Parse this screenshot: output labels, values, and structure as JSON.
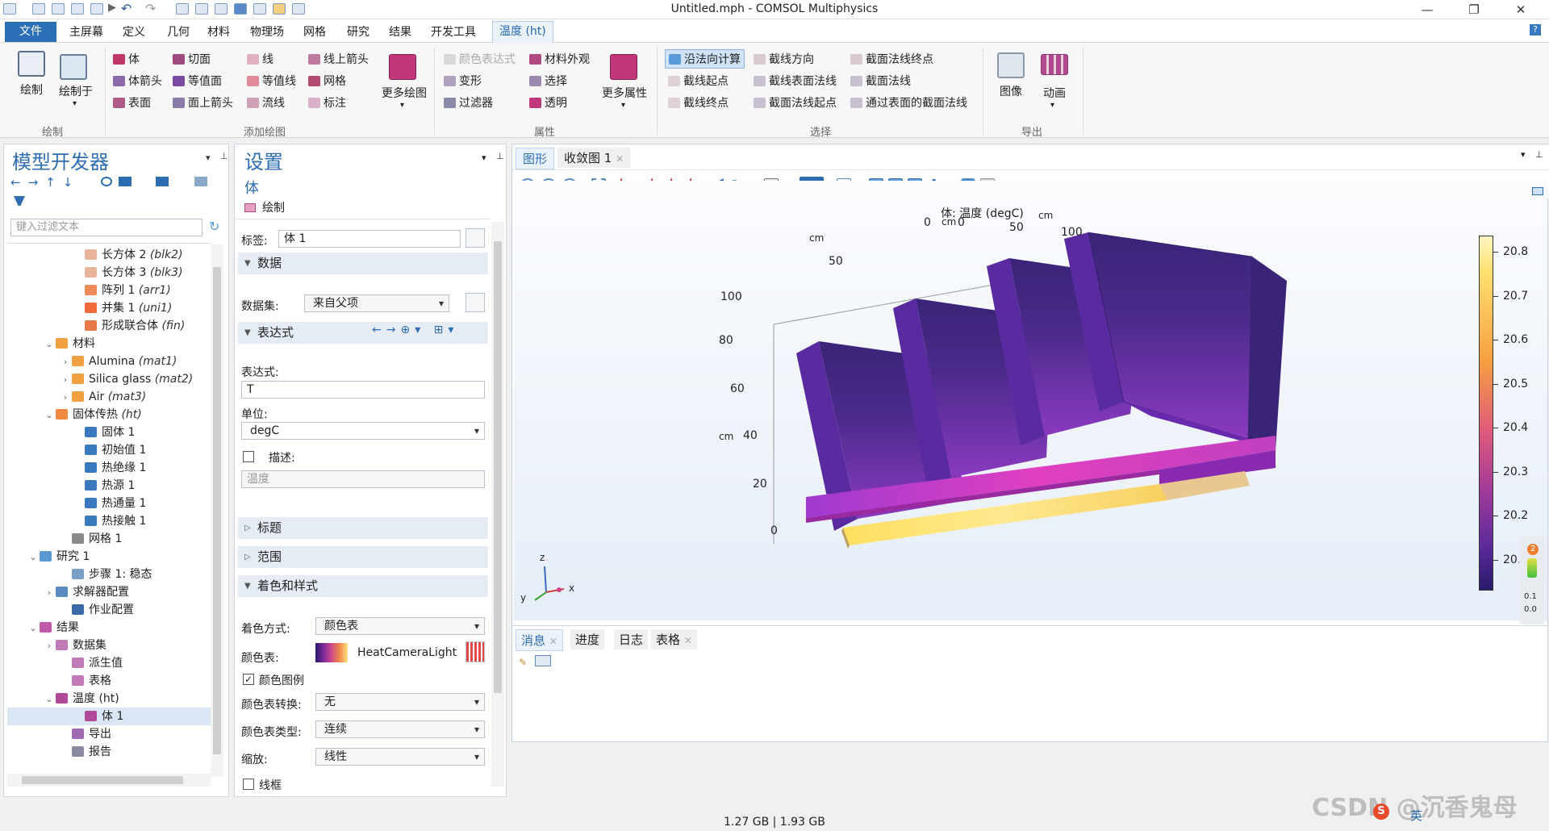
{
  "window": {
    "title": "Untitled.mph - COMSOL Multiphysics"
  },
  "menu": {
    "file": "文件",
    "items": [
      "主屏幕",
      "定义",
      "几何",
      "材料",
      "物理场",
      "网格",
      "研究",
      "结果",
      "开发工具"
    ],
    "context_tab": "温度 (ht)",
    "help": "?"
  },
  "ribbon": {
    "plot": {
      "label": "绘制",
      "plot_in": "绘制于",
      "group": "绘制"
    },
    "add_plot": {
      "group": "添加绘图",
      "col1": [
        "体",
        "体箭头",
        "表面"
      ],
      "col2": [
        "切面",
        "等值面",
        "面上箭头"
      ],
      "col3": [
        "线",
        "等值线",
        "流线"
      ],
      "col4": [
        "线上箭头",
        "网格",
        "标注"
      ],
      "more": "更多绘图"
    },
    "attributes": {
      "group": "属性",
      "col1": [
        "颜色表达式",
        "变形",
        "过滤器"
      ],
      "col2": [
        "材料外观",
        "选择",
        "透明"
      ],
      "more": "更多属性"
    },
    "selection": {
      "group": "选择",
      "col1": [
        "沿法向计算",
        "截线起点",
        "截线终点"
      ],
      "col2": [
        "截线方向",
        "截线表面法线",
        "截面法线起点"
      ],
      "col3": [
        "截面法线终点",
        "截面法线",
        "通过表面的截面法线"
      ]
    },
    "export": {
      "group": "导出",
      "image": "图像",
      "animation": "动画"
    }
  },
  "model_builder": {
    "title": "模型开发器",
    "filter_placeholder": "键入过滤文本",
    "tree": [
      {
        "label": "长方体 2",
        "tag": "(blk2)",
        "indent": 80,
        "arrow": "",
        "color": "#e8b49a"
      },
      {
        "label": "长方体 3",
        "tag": "(blk3)",
        "indent": 80,
        "arrow": "",
        "color": "#e8b49a"
      },
      {
        "label": "阵列 1",
        "tag": "(arr1)",
        "indent": 80,
        "arrow": "",
        "color": "#f08a5a"
      },
      {
        "label": "并集 1",
        "tag": "(uni1)",
        "indent": 80,
        "arrow": "",
        "color": "#f06a3a"
      },
      {
        "label": "形成联合体",
        "tag": "(fin)",
        "indent": 80,
        "arrow": "",
        "color": "#e87a4a"
      },
      {
        "label": "材料",
        "tag": "",
        "indent": 44,
        "arrow": "⌄",
        "color": "#f0a040"
      },
      {
        "label": "Alumina",
        "tag": "(mat1)",
        "indent": 64,
        "arrow": "›",
        "color": "#f0a040"
      },
      {
        "label": "Silica glass",
        "tag": "(mat2)",
        "indent": 64,
        "arrow": "›",
        "color": "#f0a040"
      },
      {
        "label": "Air",
        "tag": "(mat3)",
        "indent": 64,
        "arrow": "›",
        "color": "#f0a040"
      },
      {
        "label": "固体传热",
        "tag": "(ht)",
        "indent": 44,
        "arrow": "⌄",
        "color": "#f08a40"
      },
      {
        "label": "固体 1",
        "tag": "",
        "indent": 80,
        "arrow": "",
        "color": "#3a78c0"
      },
      {
        "label": "初始值 1",
        "tag": "",
        "indent": 80,
        "arrow": "",
        "color": "#3a78c0"
      },
      {
        "label": "热绝缘 1",
        "tag": "",
        "indent": 80,
        "arrow": "",
        "color": "#3a78c0"
      },
      {
        "label": "热源 1",
        "tag": "",
        "indent": 80,
        "arrow": "",
        "color": "#3a78c0"
      },
      {
        "label": "热通量 1",
        "tag": "",
        "indent": 80,
        "arrow": "",
        "color": "#3a78c0"
      },
      {
        "label": "热接触 1",
        "tag": "",
        "indent": 80,
        "arrow": "",
        "color": "#3a78c0"
      },
      {
        "label": "网格 1",
        "tag": "",
        "indent": 64,
        "arrow": "",
        "color": "#8a8a8a"
      },
      {
        "label": "研究 1",
        "tag": "",
        "indent": 24,
        "arrow": "⌄",
        "color": "#5a9ad0"
      },
      {
        "label": "步骤 1: 稳态",
        "tag": "",
        "indent": 64,
        "arrow": "",
        "color": "#7aa0c8"
      },
      {
        "label": "求解器配置",
        "tag": "",
        "indent": 44,
        "arrow": "›",
        "color": "#5a8ac0"
      },
      {
        "label": "作业配置",
        "tag": "",
        "indent": 64,
        "arrow": "",
        "color": "#3a6aa8"
      },
      {
        "label": "结果",
        "tag": "",
        "indent": 24,
        "arrow": "⌄",
        "color": "#c05aa8"
      },
      {
        "label": "数据集",
        "tag": "",
        "indent": 44,
        "arrow": "›",
        "color": "#c07ab8"
      },
      {
        "label": "派生值",
        "tag": "",
        "indent": 64,
        "arrow": "",
        "color": "#c07ab8"
      },
      {
        "label": "表格",
        "tag": "",
        "indent": 64,
        "arrow": "",
        "color": "#c07ab8"
      },
      {
        "label": "温度 (ht)",
        "tag": "",
        "indent": 44,
        "arrow": "⌄",
        "color": "#b04a98"
      },
      {
        "label": "体 1",
        "tag": "",
        "indent": 80,
        "arrow": "",
        "color": "#b04a98",
        "selected": true
      },
      {
        "label": "导出",
        "tag": "",
        "indent": 64,
        "arrow": "",
        "color": "#a06ab0"
      },
      {
        "label": "报告",
        "tag": "",
        "indent": 64,
        "arrow": "",
        "color": "#8a8aa0"
      }
    ]
  },
  "settings": {
    "title": "设置",
    "subtitle": "体",
    "plot_button": "绘制",
    "label_label": "标签:",
    "label_value": "体 1",
    "sec_data": "数据",
    "dataset_label": "数据集:",
    "dataset_value": "来自父项",
    "sec_expression": "表达式",
    "expression_label": "表达式:",
    "expression_value": "T",
    "unit_label": "单位:",
    "unit_value": "degC",
    "description_label": "描述:",
    "description_value": "温度",
    "sec_title": "标题",
    "sec_range": "范围",
    "sec_coloring": "着色和样式",
    "coloring_label": "着色方式:",
    "coloring_value": "颜色表",
    "colortable_label": "颜色表:",
    "colortable_value": "HeatCameraLight",
    "color_legend": "颜色图例",
    "transform_label": "颜色表转换:",
    "transform_value": "无",
    "type_label": "颜色表类型:",
    "type_value": "连续",
    "scale_label": "缩放:",
    "scale_value": "线性",
    "wireframe": "线框"
  },
  "graphics": {
    "tab_graphics": "图形",
    "tab_convergence": "收敛图 1",
    "plot_title": "体: 温度 (degC)",
    "axis_unit": "cm",
    "x_ticks": [
      "0",
      "50",
      "100"
    ],
    "y_ticks": [
      "0",
      "50"
    ],
    "z_ticks": [
      "100",
      "80",
      "60",
      "40",
      "20",
      "0"
    ],
    "colorbar_ticks": [
      "20.8",
      "20.7",
      "20.6",
      "20.5",
      "20.4",
      "20.3",
      "20.2",
      "20.1"
    ],
    "colorbar_min": 20.1,
    "colorbar_max": 20.8,
    "triad": {
      "x": "x",
      "y": "y",
      "z": "z"
    },
    "side_badge": "2",
    "side_values": [
      "0.1",
      "0.0"
    ]
  },
  "bottom_tabs": [
    "消息",
    "进度",
    "日志",
    "表格"
  ],
  "status": {
    "memory": "1.27 GB | 1.93 GB"
  },
  "watermark": "CSDN @沉香鬼母",
  "ime": {
    "lang": "英"
  }
}
